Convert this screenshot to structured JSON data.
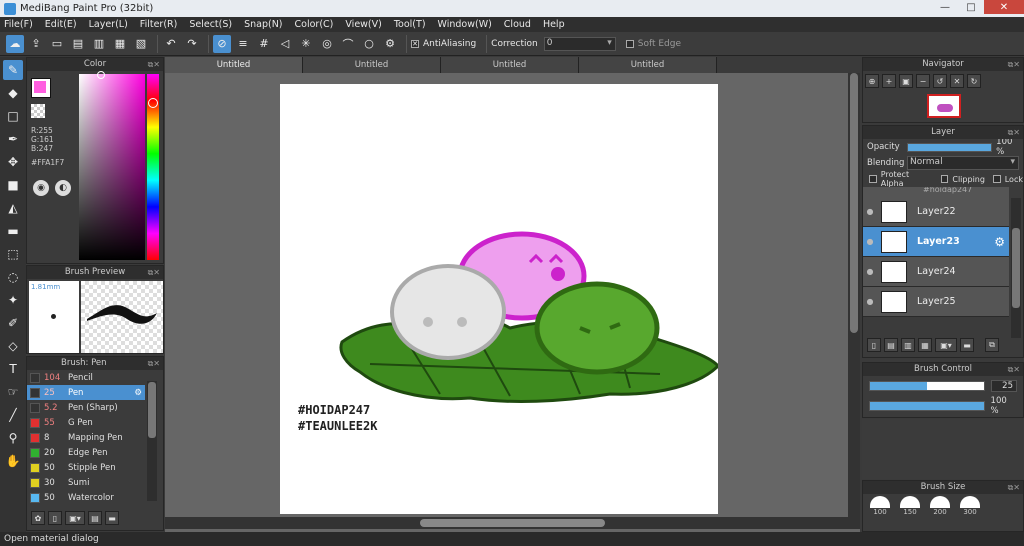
{
  "window": {
    "title": "MediBang Paint Pro (32bit)",
    "minimize": "—",
    "maximize": "□",
    "close": "✕"
  },
  "menu": [
    "File(F)",
    "Edit(E)",
    "Layer(L)",
    "Filter(R)",
    "Select(S)",
    "Snap(N)",
    "Color(C)",
    "View(V)",
    "Tool(T)",
    "Window(W)",
    "Cloud",
    "Help"
  ],
  "toolbar": {
    "antialiasing_label": "AntiAliasing",
    "correction_label": "Correction",
    "correction_value": "0",
    "soft_edge_label": "Soft Edge"
  },
  "color_panel": {
    "title": "Color",
    "r": "R:255",
    "g": "G:161",
    "b": "B:247",
    "hex": "#FFA1F7",
    "primary": "#ff5fe0",
    "secondary": "#ffffff"
  },
  "brush_preview": {
    "title": "Brush Preview",
    "size": "1.81mm"
  },
  "brush_list": {
    "title": "Brush: Pen",
    "items": [
      {
        "size": "104",
        "name": "Pencil",
        "color": "#333333"
      },
      {
        "size": "25",
        "name": "Pen",
        "color": "#333333",
        "selected": true
      },
      {
        "size": "5.2",
        "name": "Pen (Sharp)",
        "color": "#333333"
      },
      {
        "size": "55",
        "name": "G Pen",
        "color": "#e03030"
      },
      {
        "size": "8",
        "name": "Mapping Pen",
        "color": "#e03030"
      },
      {
        "size": "20",
        "name": "Edge Pen",
        "color": "#30b030"
      },
      {
        "size": "50",
        "name": "Stipple Pen",
        "color": "#e0d020"
      },
      {
        "size": "30",
        "name": "Sumi",
        "color": "#e0d020"
      },
      {
        "size": "50",
        "name": "Watercolor",
        "color": "#58b8f0"
      }
    ]
  },
  "tabs": [
    "Untitled",
    "Untitled",
    "Untitled",
    "Untitled"
  ],
  "artwork": {
    "line1": "#HOIDAP247",
    "line2": "#TEAUNLEE2K"
  },
  "navigator": {
    "title": "Navigator"
  },
  "layer_panel": {
    "title": "Layer",
    "opacity_label": "Opacity",
    "opacity_value": "100 %",
    "opacity": 1.0,
    "blending_label": "Blending",
    "blending_value": "Normal",
    "protect_alpha": "Protect Alpha",
    "clipping": "Clipping",
    "lock": "Lock",
    "partial_layer": "#hoidap247",
    "layers": [
      {
        "name": "Layer22"
      },
      {
        "name": "Layer23",
        "selected": true
      },
      {
        "name": "Layer24"
      },
      {
        "name": "Layer25"
      }
    ]
  },
  "brush_control": {
    "title": "Brush Control",
    "size_value": "25",
    "size_fraction": 0.5,
    "opacity_value": "100 %",
    "opacity": 1.0
  },
  "brush_size": {
    "title": "Brush Size",
    "sizes": [
      "100",
      "150",
      "200",
      "300"
    ]
  },
  "status": {
    "text": "Open material dialog"
  }
}
